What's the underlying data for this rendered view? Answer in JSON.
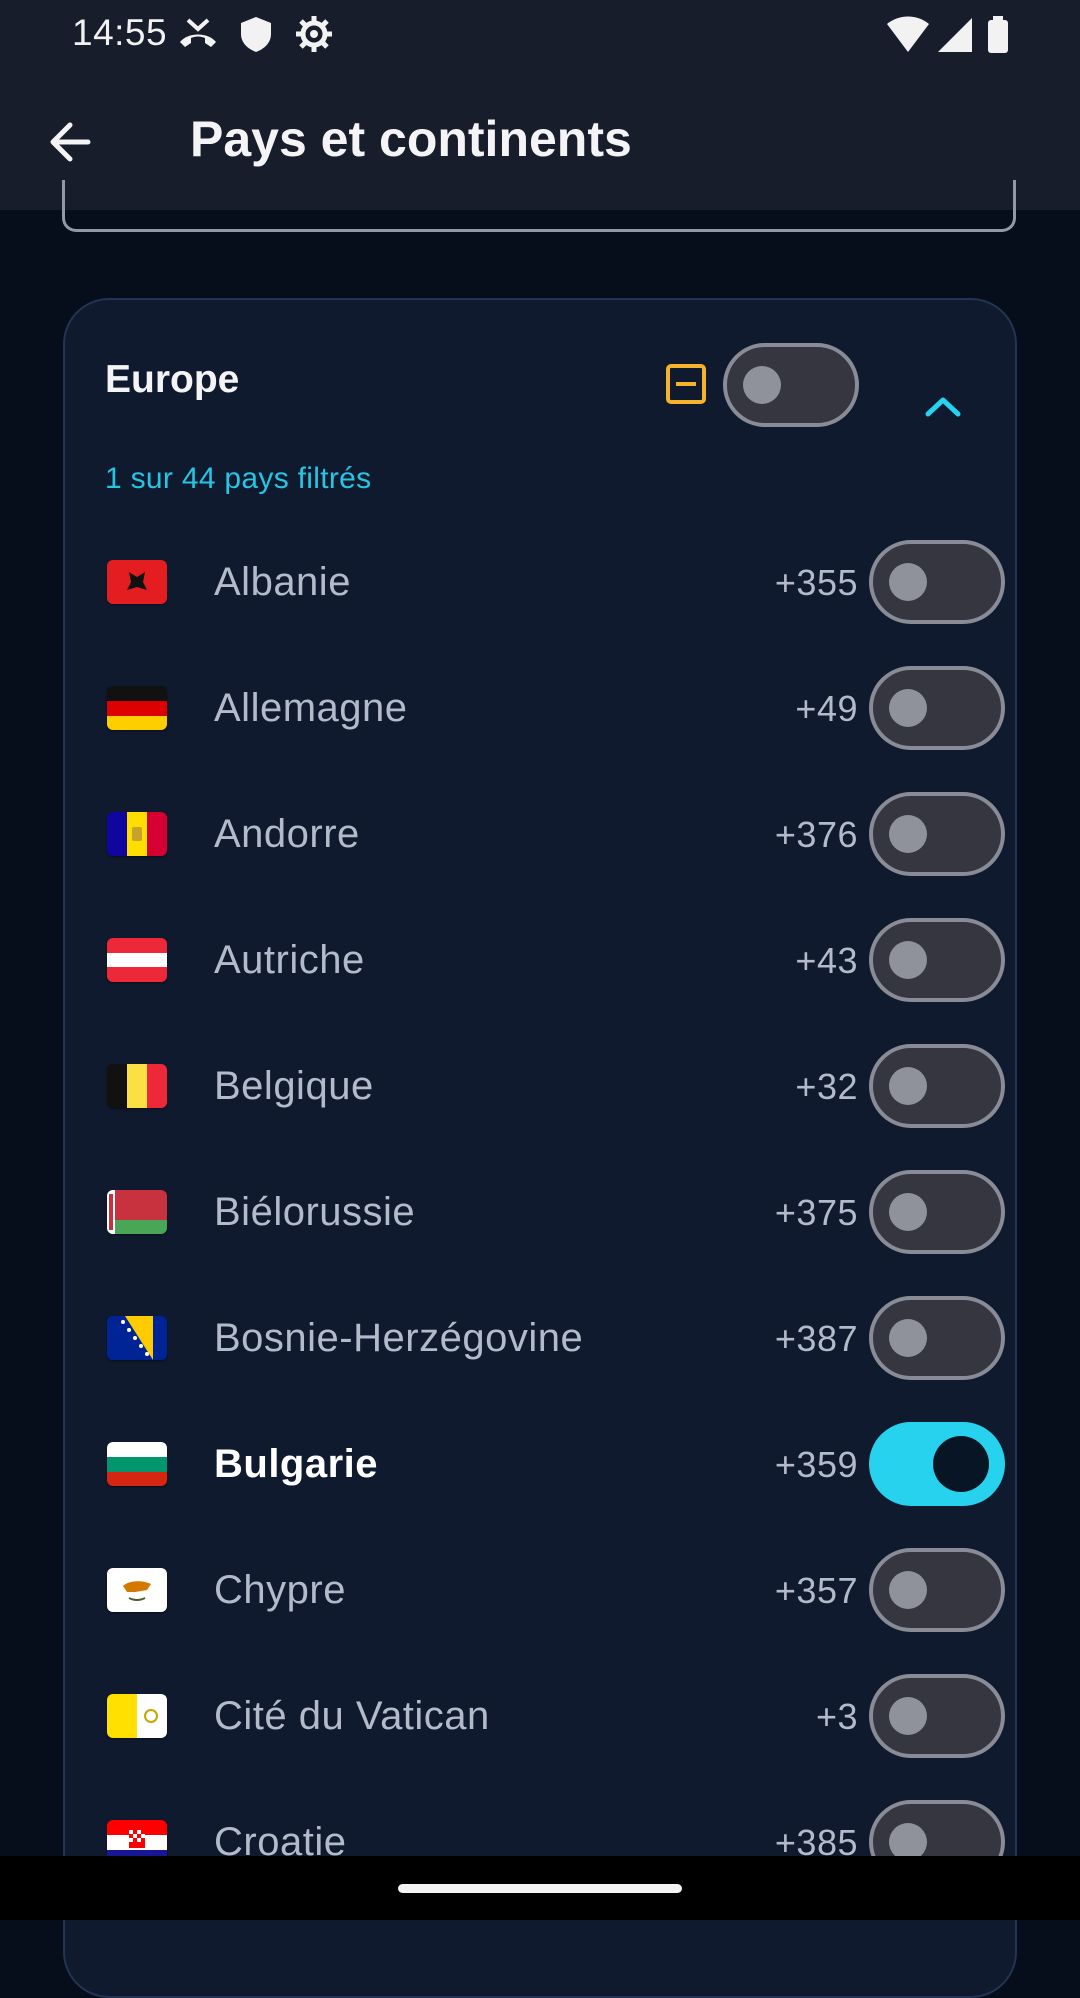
{
  "status_bar": {
    "time": "14:55",
    "left_icons": [
      "missed-call-icon",
      "shield-icon",
      "settings-gear-icon"
    ],
    "right_icons": [
      "wifi-icon",
      "cell-signal-icon",
      "battery-icon"
    ]
  },
  "app_bar": {
    "back_icon": "arrow-back-icon",
    "title": "Pays et continents"
  },
  "region": {
    "name": "Europe",
    "select_state": "indeterminate",
    "toggle_on": false,
    "expand_icon": "chevron-up-icon",
    "filter_summary": "1 sur 44 pays filtrés",
    "countries": [
      {
        "name": "Albanie",
        "dial": "+355",
        "flag": "flag-albania",
        "on": false
      },
      {
        "name": "Allemagne",
        "dial": "+49",
        "flag": "flag-germany",
        "on": false
      },
      {
        "name": "Andorre",
        "dial": "+376",
        "flag": "flag-andorra",
        "on": false
      },
      {
        "name": "Autriche",
        "dial": "+43",
        "flag": "flag-austria",
        "on": false
      },
      {
        "name": "Belgique",
        "dial": "+32",
        "flag": "flag-belgium",
        "on": false
      },
      {
        "name": "Biélorussie",
        "dial": "+375",
        "flag": "flag-belarus",
        "on": false
      },
      {
        "name": "Bosnie-Herzégovine",
        "dial": "+387",
        "flag": "flag-bosnia",
        "on": false
      },
      {
        "name": "Bulgarie",
        "dial": "+359",
        "flag": "flag-bulgaria",
        "on": true
      },
      {
        "name": "Chypre",
        "dial": "+357",
        "flag": "flag-cyprus",
        "on": false
      },
      {
        "name": "Cité du Vatican",
        "dial": "+3",
        "flag": "flag-vatican",
        "on": false
      },
      {
        "name": "Croatie",
        "dial": "+385",
        "flag": "flag-croatia",
        "on": false
      }
    ]
  },
  "colors": {
    "accent": "#26d2ed",
    "indeterminate": "#f4b22d",
    "card_bg": "#101a2e",
    "page_bg": "#060d1b",
    "bar_bg": "#181d2c"
  }
}
